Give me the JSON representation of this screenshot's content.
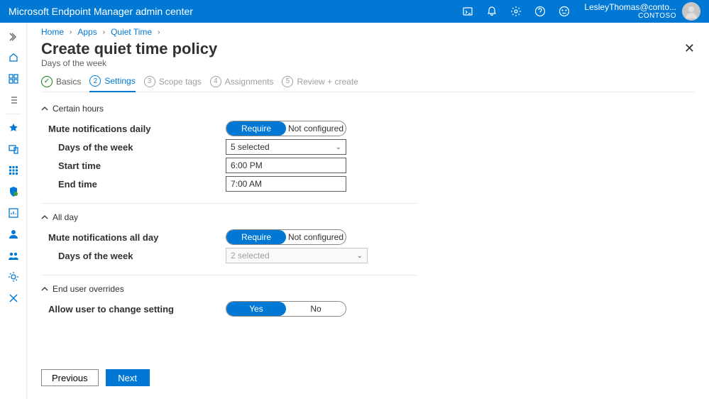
{
  "header": {
    "product_title": "Microsoft Endpoint Manager admin center",
    "user_name": "LesleyThomas@conto...",
    "user_org": "CONTOSO"
  },
  "breadcrumb": {
    "items": [
      "Home",
      "Apps",
      "Quiet Time"
    ]
  },
  "page": {
    "title": "Create quiet time policy",
    "subtitle": "Days of the week"
  },
  "wizard": {
    "steps": [
      {
        "num_or_mark": "✓",
        "label": "Basics"
      },
      {
        "num_or_mark": "2",
        "label": "Settings"
      },
      {
        "num_or_mark": "3",
        "label": "Scope tags"
      },
      {
        "num_or_mark": "4",
        "label": "Assignments"
      },
      {
        "num_or_mark": "5",
        "label": "Review + create"
      }
    ],
    "current_index": 1
  },
  "sections": {
    "certain_hours": {
      "title": "Certain hours",
      "mute_label": "Mute notifications daily",
      "toggle": {
        "opt_a": "Require",
        "opt_b": "Not configured",
        "selected": "a"
      },
      "days_label": "Days of the week",
      "days_value": "5 selected",
      "start_label": "Start time",
      "start_value": "6:00 PM",
      "end_label": "End time",
      "end_value": "7:00 AM"
    },
    "all_day": {
      "title": "All day",
      "mute_label": "Mute notifications all day",
      "toggle": {
        "opt_a": "Require",
        "opt_b": "Not configured",
        "selected": "a"
      },
      "days_label": "Days of the week",
      "days_value": "2 selected"
    },
    "overrides": {
      "title": "End user overrides",
      "allow_label": "Allow user to change setting",
      "toggle": {
        "opt_a": "Yes",
        "opt_b": "No",
        "selected": "a"
      }
    }
  },
  "footer": {
    "previous": "Previous",
    "next": "Next"
  }
}
